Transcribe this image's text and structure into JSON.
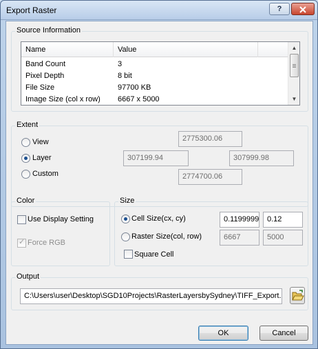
{
  "window": {
    "title": "Export Raster",
    "help_label": "?",
    "close_label": "x"
  },
  "source_info": {
    "label": "Source Information",
    "columns": [
      "Name",
      "Value"
    ],
    "rows": [
      {
        "name": "Band Count",
        "value": "3"
      },
      {
        "name": "Pixel Depth",
        "value": "8 bit"
      },
      {
        "name": "File Size",
        "value": "97700 KB"
      },
      {
        "name": "Image Size (col x row)",
        "value": "6667 x 5000"
      }
    ]
  },
  "extent": {
    "label": "Extent",
    "options": [
      {
        "label": "View",
        "selected": false
      },
      {
        "label": "Layer",
        "selected": true
      },
      {
        "label": "Custom",
        "selected": false
      }
    ],
    "top": "2775300.06",
    "left": "307199.94",
    "right": "307999.98",
    "bottom": "2774700.06"
  },
  "color": {
    "label": "Color",
    "use_display_setting": {
      "label": "Use Display Setting",
      "checked": false
    },
    "force_rgb": {
      "label": "Force RGB",
      "checked": true,
      "enabled": false
    }
  },
  "size": {
    "label": "Size",
    "cell_size": {
      "label": "Cell Size(cx, cy)",
      "selected": true,
      "cx": "0.1199999",
      "cy": "0.12"
    },
    "raster_size": {
      "label": "Raster Size(col, row)",
      "selected": false,
      "col": "6667",
      "row": "5000"
    },
    "square_cell": {
      "label": "Square Cell",
      "checked": false
    }
  },
  "output": {
    "label": "Output",
    "path": "C:\\Users\\user\\Desktop\\SGD10Projects\\RasterLayersbySydney\\TIFF_Export.",
    "browse_icon": "folder-open-icon"
  },
  "buttons": {
    "ok": "OK",
    "cancel": "Cancel"
  }
}
